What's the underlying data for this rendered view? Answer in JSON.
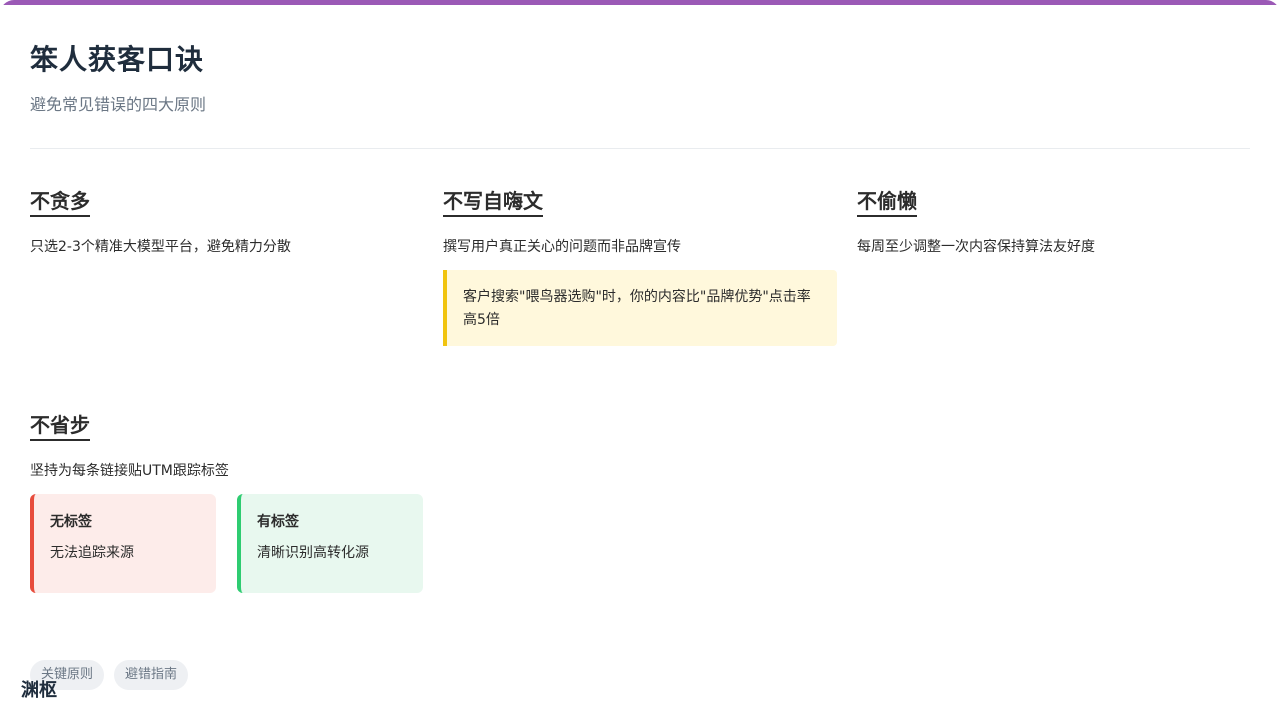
{
  "header": {
    "title": "笨人获客口诀",
    "subtitle": "避免常见错误的四大原则"
  },
  "principles": [
    {
      "title": "不贪多",
      "desc": "只选2-3个精准大模型平台，避免精力分散"
    },
    {
      "title": "不写自嗨文",
      "desc": "撰写用户真正关心的问题而非品牌宣传",
      "quote": "客户搜索\"喂鸟器选购\"时，你的内容比\"品牌优势\"点击率高5倍"
    },
    {
      "title": "不偷懒",
      "desc": "每周至少调整一次内容保持算法友好度"
    },
    {
      "title": "不省步",
      "desc": "坚持为每条链接贴UTM跟踪标签"
    }
  ],
  "comparison": {
    "bad": {
      "title": "无标签",
      "text": "无法追踪来源"
    },
    "good": {
      "title": "有标签",
      "text": "清晰识别高转化源"
    }
  },
  "tags": [
    "关键原则",
    "避错指南"
  ],
  "brand": "渊枢",
  "colors": {
    "accent": "#9b59b6",
    "quote_border": "#f1c40f",
    "bad": "#e74c3c",
    "good": "#2ecc71"
  }
}
